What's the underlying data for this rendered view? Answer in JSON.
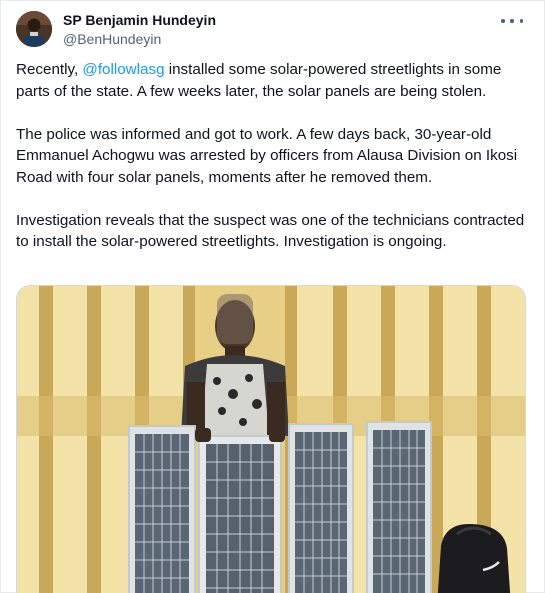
{
  "author": {
    "display_name": "SP Benjamin Hundeyin",
    "handle": "@BenHundeyin"
  },
  "tweet": {
    "p1_before": "Recently, ",
    "p1_mention": "@followlasg",
    "p1_after": " installed some solar-powered streetlights in some parts of the state. A few weeks later, the solar panels are being stolen.",
    "p2": "The police was informed and got to work. A few days back, 30-year-old Emmanuel Achogwu was arrested by officers from Alausa Division on Ikosi Road with four solar panels, moments after he removed them.",
    "p3": "Investigation reveals that the suspect was one of the technicians contracted to install the solar-powered streetlights. Investigation is ongoing."
  },
  "icons": {
    "more": "more-horizontal-icon"
  },
  "colors": {
    "text": "#0f1419",
    "secondary": "#536471",
    "link": "#1d9bf0"
  }
}
